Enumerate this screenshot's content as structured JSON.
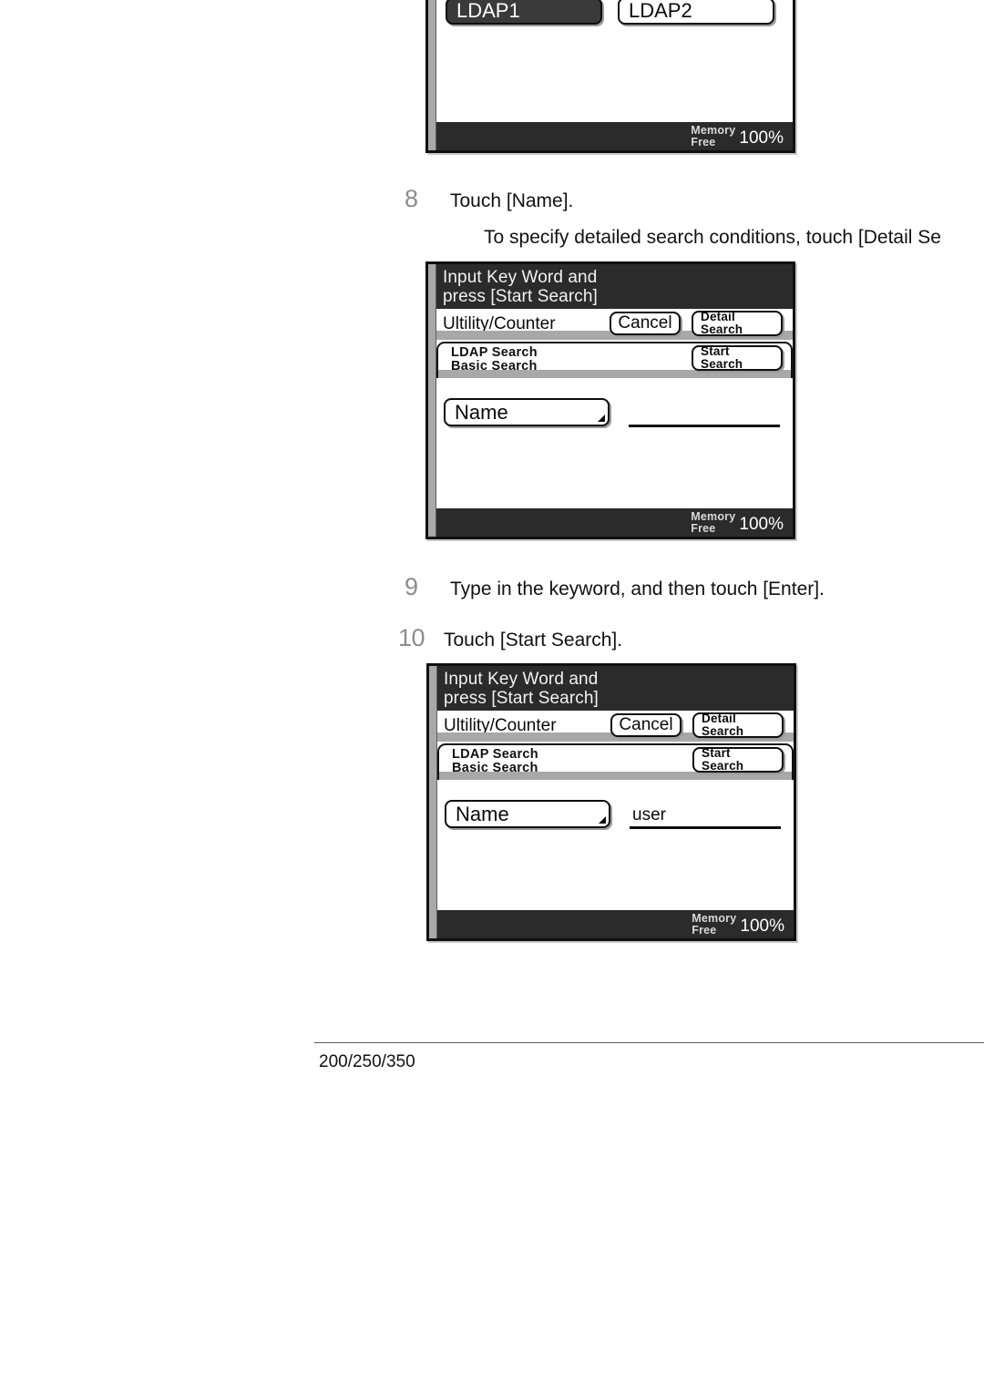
{
  "document": {
    "footer_model": "200/250/350"
  },
  "panel_top": {
    "name": "ldap-server-select-panel",
    "buttons": [
      {
        "label": "LDAP1",
        "selected": true
      },
      {
        "label": "LDAP2",
        "selected": false
      }
    ],
    "memory": {
      "label_line1": "Memory",
      "label_line2": "Free",
      "value": "100%"
    }
  },
  "steps": [
    {
      "number": "8",
      "text": "Touch [Name]."
    },
    {
      "number": "9",
      "text": "Type in the keyword, and then touch [Enter]."
    },
    {
      "number": "10",
      "text": "Touch [Start Search]."
    }
  ],
  "substep_8": "To specify detailed search conditions, touch [Detail Se",
  "panel_mid": {
    "name": "ldap-basic-search-panel-empty",
    "message_line1": "Input Key Word and",
    "message_line2": "press [Start Search]",
    "utility_title": "Ultility/Counter",
    "cancel_label": "Cancel",
    "detail_search_line1": "Detail",
    "detail_search_line2": "Search",
    "ldap_line1": "LDAP Search",
    "ldap_line2": "Basic Search",
    "start_search_line1": "Start",
    "start_search_line2": "Search",
    "name_button_label": "Name",
    "keyword_value": "",
    "memory": {
      "label_line1": "Memory",
      "label_line2": "Free",
      "value": "100%"
    }
  },
  "panel_bottom": {
    "name": "ldap-basic-search-panel-filled",
    "message_line1": "Input Key Word and",
    "message_line2": "press [Start Search]",
    "utility_title": "Ultility/Counter",
    "cancel_label": "Cancel",
    "detail_search_line1": "Detail",
    "detail_search_line2": "Search",
    "ldap_line1": "LDAP Search",
    "ldap_line2": "Basic Search",
    "start_search_line1": "Start",
    "start_search_line2": "Search",
    "name_button_label": "Name",
    "keyword_value": "user",
    "memory": {
      "label_line1": "Memory",
      "label_line2": "Free",
      "value": "100%"
    }
  }
}
